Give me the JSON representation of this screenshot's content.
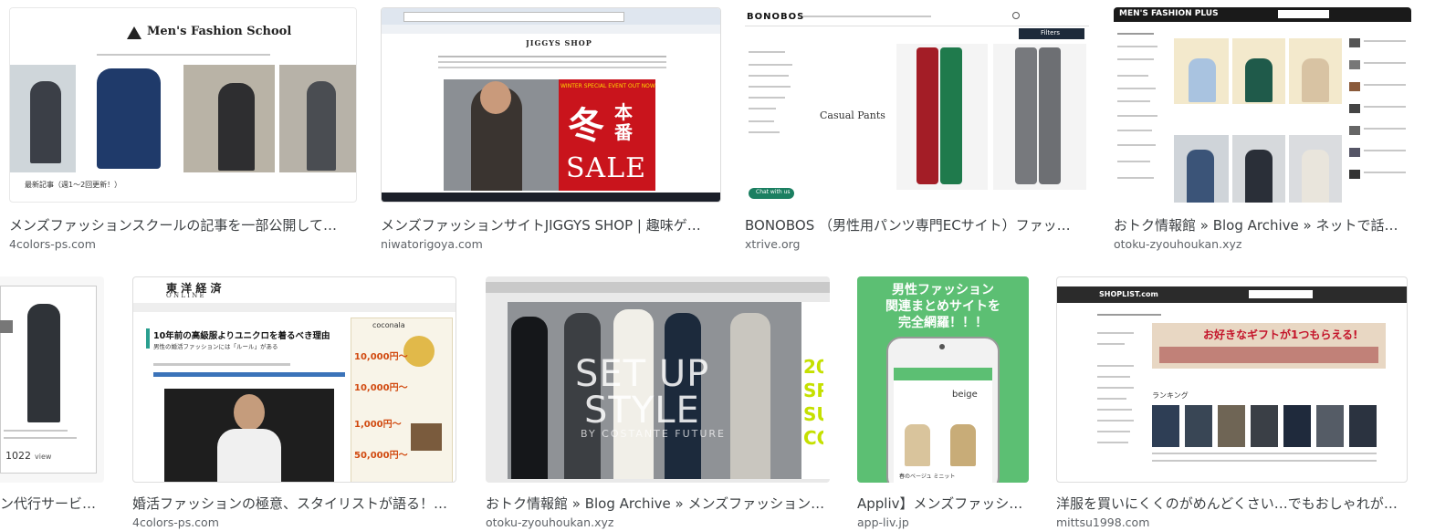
{
  "results": [
    {
      "caption": "メンズファッションスクールの記事を一部公開して…",
      "source": "4colors-ps.com",
      "thumb": {
        "site_title": "Men's Fashion School",
        "footer": "最新記事（週1〜2回更新！）"
      }
    },
    {
      "caption": "メンズファッションサイトJIGGYS SHOP | 趣味ゲ…",
      "source": "niwatorigoya.com",
      "thumb": {
        "site_title": "JIGGYS SHOP",
        "banner": "WINTER SPECIAL EVENT OUT NOW",
        "kanji_1": "冬",
        "kanji_2": "本",
        "kanji_3": "番",
        "sale": "SALE"
      }
    },
    {
      "caption": "BONOBOS （男性用パンツ専門ECサイト）ファッ…",
      "source": "xtrive.org",
      "thumb": {
        "logo": "BONOBOS",
        "heading": "Casual Pants",
        "filter_btn": "Filters",
        "chat_btn": "Chat with us"
      }
    },
    {
      "caption": "おトク情報館 » Blog Archive » ネットで話題…",
      "source": "otoku-zyouhoukan.xyz",
      "thumb": {
        "site_title": "MEN'S FASHION PLUS"
      }
    },
    {
      "caption": "ン代行サービ…",
      "source": "",
      "thumb": {
        "count": "1022",
        "unit": "view"
      }
    },
    {
      "caption": "婚活ファッションの極意、スタイリストが語る！…",
      "source": "4colors-ps.com",
      "thumb": {
        "logo": "東 洋 経 済",
        "logo_sub": "O N L I N E",
        "headline": "10年前の高級服よりユニクロを着るべき理由",
        "subhead": "男性の婚活ファッションには「ルール」がある",
        "side_brand": "coconala",
        "price_1": "10,000円〜",
        "price_2": "10,000円〜",
        "price_3": "1,000円〜",
        "price_4": "50,000円〜"
      }
    },
    {
      "caption": "おトク情報館 » Blog Archive » メンズファッション…",
      "source": "otoku-zyouhoukan.xyz",
      "thumb": {
        "overlay_1": "SET UP",
        "overlay_2": "STYLE",
        "overlay_3": "BY COSTANTE FUTURE",
        "side_text": "20 SP SU CO"
      }
    },
    {
      "caption": "Appliv】メンズファッシ…",
      "source": "app-liv.jp",
      "thumb": {
        "banner_line_1": "男性ファッション",
        "banner_line_2": "関連まとめサイトを",
        "banner_line_3": "完全網羅！！！",
        "phone_label": "beige",
        "phone_caption": "春のベージュ ミニット"
      }
    },
    {
      "caption": "洋服を買いにくくのがめんどくさい…でもおしゃれがし…",
      "source": "mittsu1998.com",
      "thumb": {
        "logo": "SHOPLIST.com",
        "banner": "お好きなギフトが1つもらえる!",
        "section": "ランキング"
      }
    }
  ]
}
